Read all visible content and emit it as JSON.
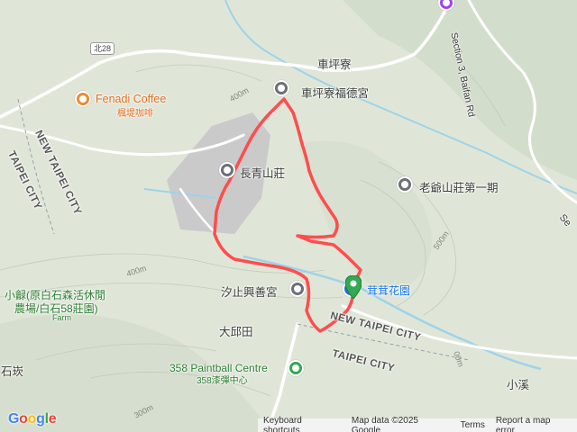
{
  "map": {
    "labels": {
      "chepingliao": "車坪寮",
      "chepingliao_temple": "車坪寮福德宮",
      "changqing": "長青山莊",
      "laoye": "老爺山莊第一期",
      "xizhi_temple": "汐止興善宮",
      "rongrong": "茸茸花園",
      "daqiutian": "大邱田",
      "paintball": "358 Paintball Centre",
      "paintball_sub": "358漆彈中心",
      "xiaoxi": "小溪",
      "shitan": "石崁",
      "xiaoyu_line1": "小龣(原白石森活休閒",
      "xiaoyu_line2": "農場/白石58莊園)",
      "xiaoyu_sub": "Farm",
      "fenadi": "Fenadi Coffee",
      "fenadi_sub": "楓堤咖啡",
      "road_shield": "北28",
      "road_baifan": "Section 3, Baifan Rd",
      "road_se": "Se",
      "boundary_new_taipei_left": "NEW TAIPEI CITY",
      "boundary_taipei_left": "TAIPEI CITY",
      "boundary_new_taipei_bottom": "NEW TAIPEI CITY",
      "boundary_taipei_bottom": "TAIPEI CITY",
      "contour_400_a": "400m",
      "contour_400_b": "400m",
      "contour_500": "500m",
      "contour_300": "300m",
      "contour_00": "00m"
    },
    "colors": {
      "terrain": "#dfe6d8",
      "track": "#ff4d4d",
      "road": "#ffffff",
      "river": "#9fd3e8"
    }
  },
  "attribution": {
    "shortcuts": "Keyboard shortcuts",
    "map_data": "Map data ©2025 Google",
    "terms": "Terms",
    "report": "Report a map error"
  },
  "logo": {
    "letters": [
      "G",
      "o",
      "o",
      "g",
      "l",
      "e"
    ]
  }
}
